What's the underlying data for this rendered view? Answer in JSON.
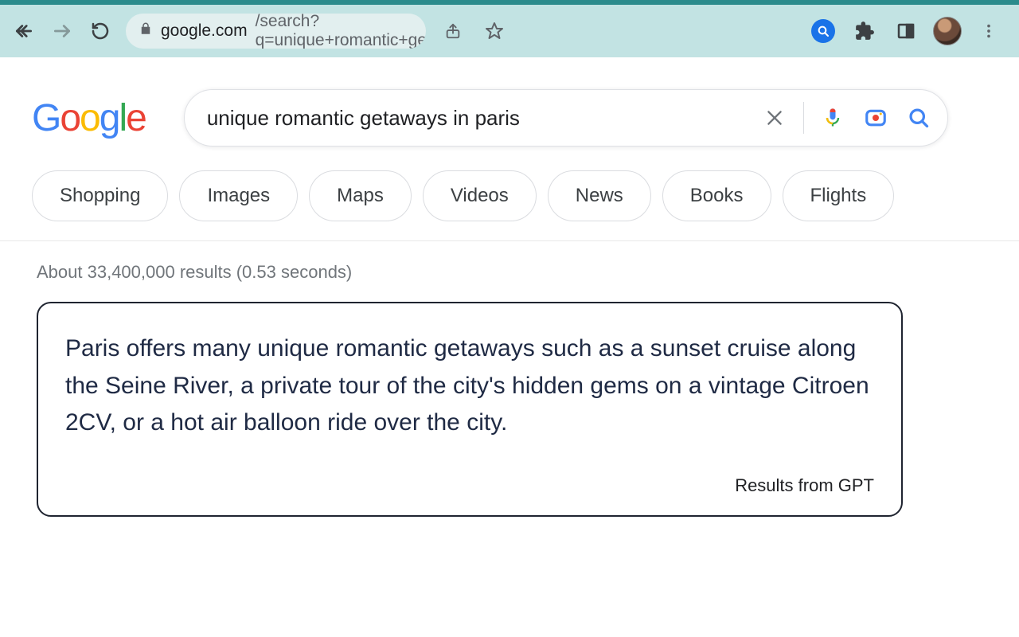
{
  "browser": {
    "url_host": "google.com",
    "url_path": "/search?q=unique+romantic+getaw…"
  },
  "search": {
    "query": "unique romantic getaways in paris"
  },
  "tabs": [
    "Shopping",
    "Images",
    "Maps",
    "Videos",
    "News",
    "Books",
    "Flights"
  ],
  "results": {
    "stats": "About 33,400,000 results (0.53 seconds)",
    "gpt_answer": "Paris offers many unique romantic getaways such as a sunset cruise along the Seine River, a private tour of the city's hidden gems on a vintage Citroen 2CV, or a hot air balloon ride over the city.",
    "gpt_attribution": "Results from GPT"
  }
}
